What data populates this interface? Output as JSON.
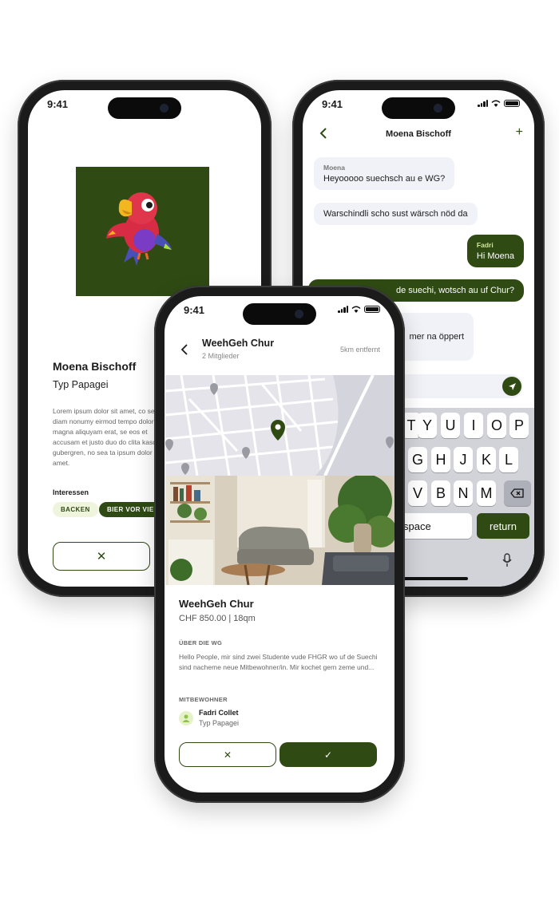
{
  "colors": {
    "accent": "#2f4a13",
    "accent_light": "#eef5dc",
    "bubble_gray": "#f1f2f7",
    "map_bg": "#e4e4ea"
  },
  "status_time": "9:41",
  "profile": {
    "name": "Moena Bischoff",
    "subtitle": "Typ Papagei",
    "bio": "Lorem ipsum dolor sit amet, co sed diam nonumy eirmod tempo dolore magna aliquyam erat, se eos et accusam et justo duo do clita kasd gubergren, no sea ta ipsum dolor sit amet.",
    "interests_label": "Interessen",
    "interests": [
      "BACKEN",
      "BIER VOR VIER"
    ],
    "reject_icon": "close-icon",
    "accept_icon": "check-icon"
  },
  "chat": {
    "header_title": "Moena Bischoff",
    "back_icon": "chevron-left-icon",
    "add_label": "+",
    "messages": [
      {
        "sender": "Moena",
        "text": "Heyooooo suechsch au e WG?",
        "side": "left"
      },
      {
        "sender": "",
        "text": "Warschindli scho sust wärsch nöd da",
        "side": "left"
      },
      {
        "sender": "Fadri",
        "text": "Hi Moena",
        "side": "right"
      },
      {
        "sender": "",
        "text": "de suechi, wotsch au uf Chur?",
        "side": "right"
      },
      {
        "sender": "",
        "text": "mer na öppert",
        "side": "left"
      }
    ],
    "send_icon": "send-icon",
    "keyboard_rows": [
      [
        "T",
        "Y",
        "U",
        "I",
        "O",
        "P"
      ],
      [
        "G",
        "H",
        "J",
        "K",
        "L"
      ],
      [
        "V",
        "B",
        "N",
        "M"
      ]
    ],
    "space_label": "space",
    "return_label": "return",
    "mic_icon": "mic-icon",
    "delete_icon": "backspace-icon"
  },
  "wg": {
    "header_title": "WeehGeh Chur",
    "members": "2 Mitglieder",
    "distance": "5km entfernt",
    "title": "WeehGeh Chur",
    "price": "CHF 850.00 | 18qm",
    "about_label": "ÜBER DIE WG",
    "about_text": "Hello People, mir sind zwei Studente vude FHGR wo uf de Suechi sind nacheme neue Mitbewohner/in. Mir kochet gern zeme und...",
    "roommates_label": "MITBEWOHNER",
    "roommate_name": "Fadri Collet",
    "roommate_type": "Typ Papagei",
    "reject_label": "✕",
    "accept_label": "✓"
  }
}
